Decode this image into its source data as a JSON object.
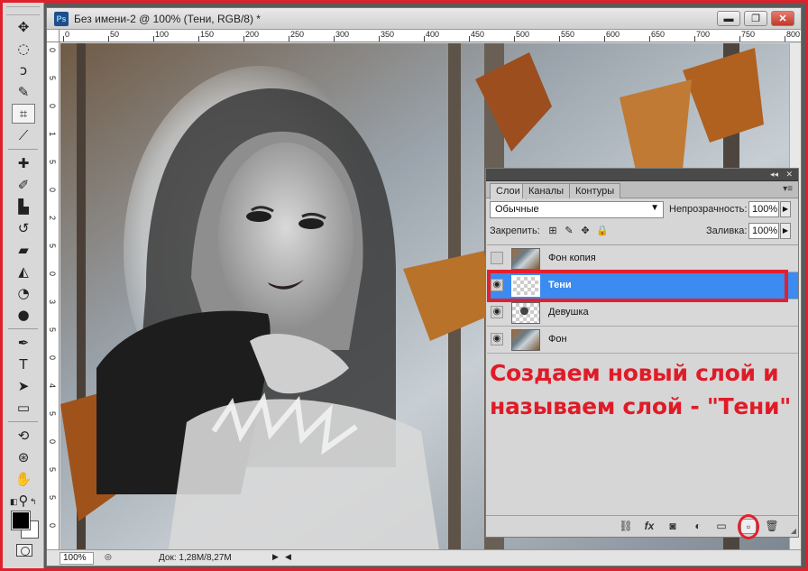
{
  "window": {
    "app_icon": "Ps",
    "title": "Без имени-2 @ 100% (Тени, RGB/8) *",
    "min_glyph": "▬",
    "max_glyph": "❐",
    "close_glyph": "✕"
  },
  "rulers": {
    "top": [
      "0",
      "50",
      "100",
      "150",
      "200",
      "250",
      "300",
      "350",
      "400",
      "450",
      "500",
      "550",
      "600",
      "650",
      "700",
      "750",
      "800"
    ],
    "left": [
      "0",
      "5",
      "0",
      "1",
      "5",
      "0",
      "2",
      "5",
      "0",
      "3",
      "5",
      "0",
      "4",
      "5",
      "0",
      "5",
      "5",
      "0"
    ]
  },
  "statusbar": {
    "zoom": "100%",
    "doc_info": "Док: 1,28M/8,27M",
    "arrow": "▶",
    "left_arrow": "◀"
  },
  "layers_panel": {
    "tabs": [
      {
        "label": "Слои",
        "active": true
      },
      {
        "label": "Каналы",
        "active": false
      },
      {
        "label": "Контуры",
        "active": false
      }
    ],
    "blend_mode": "Обычные",
    "opacity_label": "Непрозрачность:",
    "opacity_value": "100%",
    "lock_label": "Закрепить:",
    "fill_label": "Заливка:",
    "fill_value": "100%",
    "layers": [
      {
        "name": "Фон копия",
        "visible": false,
        "thumb": "photo",
        "selected": false
      },
      {
        "name": "Тени",
        "visible": true,
        "thumb": "trans",
        "selected": true
      },
      {
        "name": "Девушка",
        "visible": true,
        "thumb": "girl",
        "selected": false
      },
      {
        "name": "Фон",
        "visible": true,
        "thumb": "photo",
        "selected": false
      }
    ],
    "footer_buttons": [
      {
        "name": "link-layers-icon",
        "glyph": "⛓"
      },
      {
        "name": "fx-icon",
        "glyph": "fx"
      },
      {
        "name": "mask-icon",
        "glyph": "◙"
      },
      {
        "name": "adjustment-icon",
        "glyph": "◐"
      },
      {
        "name": "group-folder-icon",
        "glyph": "▭"
      },
      {
        "name": "new-layer-icon",
        "glyph": "▫"
      },
      {
        "name": "trash-icon",
        "glyph": "🗑"
      }
    ]
  },
  "annotation": {
    "caption": "Создаем новый слой и называем слой - \"Тени\"",
    "accent": "#e01b28"
  },
  "colors": {
    "selection": "#3b8bf0",
    "highlight": "#e2202e"
  }
}
